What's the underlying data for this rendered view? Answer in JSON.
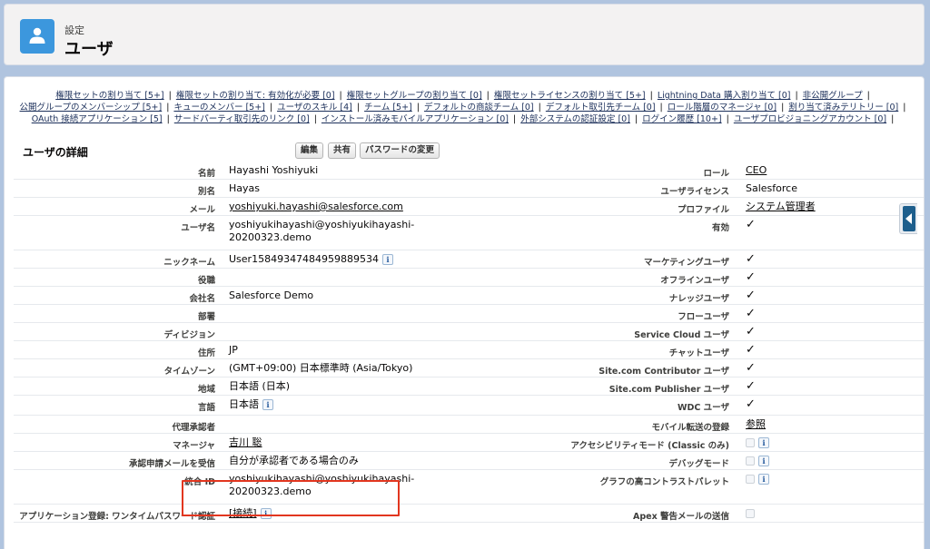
{
  "header": {
    "eyebrow": "設定",
    "title": "ユーザ",
    "icon": "user-icon"
  },
  "related_links": [
    [
      "権限セットの割り当て [5+]",
      "権限セットの割り当て: 有効化が必要 [0]",
      "権限セットグループの割り当て [0]",
      "権限セットライセンスの割り当て [5+]",
      "Lightning Data 購入割り当て [0]",
      "非公開グループ"
    ],
    [
      "公開グループのメンバーシップ [5+]",
      "キューのメンバー [5+]",
      "ユーザのスキル [4]",
      "チーム [5+]",
      "デフォルトの商談チーム [0]",
      "デフォルト取引先チーム [0]",
      "ロール階層のマネージャ [0]",
      "割り当て済みテリトリー [0]"
    ],
    [
      "OAuth 接続アプリケーション [5]",
      "サードパーティ取引先のリンク [0]",
      "インストール済みモバイルアプリケーション [0]",
      "外部システムの認証設定 [0]",
      "ログイン履歴 [10+]",
      "ユーザプロビジョニングアカウント [0]"
    ]
  ],
  "section": {
    "title": "ユーザの詳細",
    "buttons": [
      "編集",
      "共有",
      "パスワードの変更"
    ]
  },
  "left_fields": [
    {
      "label": "名前",
      "value": "Hayashi Yoshiyuki"
    },
    {
      "label": "別名",
      "value": "Hayas"
    },
    {
      "label": "メール",
      "value": "yoshiyuki.hayashi@salesforce.com",
      "link": true
    },
    {
      "label": "ユーザ名",
      "value": "yoshiyukihayashi@yoshiyukihayashi-20200323.demo"
    },
    {
      "label": "ニックネーム",
      "value": "User15849347484959889534",
      "info": true
    },
    {
      "label": "役職",
      "value": ""
    },
    {
      "label": "会社名",
      "value": "Salesforce Demo"
    },
    {
      "label": "部署",
      "value": ""
    },
    {
      "label": "ディビジョン",
      "value": ""
    },
    {
      "label": "住所",
      "value": "JP"
    },
    {
      "label": "タイムゾーン",
      "value": "(GMT+09:00) 日本標準時 (Asia/Tokyo)"
    },
    {
      "label": "地域",
      "value": "日本語 (日本)"
    },
    {
      "label": "言語",
      "value": "日本語",
      "info": true
    },
    {
      "label": "代理承認者",
      "value": ""
    },
    {
      "label": "マネージャ",
      "value": "吉川 聡",
      "link": true
    },
    {
      "label": "承認申請メールを受信",
      "value": "自分が承認者である場合のみ"
    },
    {
      "label": "統合 ID",
      "value": "yoshiyukihayashi@yoshiyukihayashi-20200323.demo"
    },
    {
      "label": "アプリケーション登録: ワンタイムパスワード認証",
      "value": "[接続]",
      "link": true,
      "info": true
    }
  ],
  "right_fields": [
    {
      "label": "ロール",
      "value": "CEO",
      "link": true
    },
    {
      "label": "ユーザライセンス",
      "value": "Salesforce"
    },
    {
      "label": "プロファイル",
      "value": "システム管理者",
      "link": true
    },
    {
      "label": "有効",
      "check": true
    },
    {
      "label": "マーケティングユーザ",
      "check": true
    },
    {
      "label": "オフラインユーザ",
      "check": true
    },
    {
      "label": "ナレッジユーザ",
      "check": true
    },
    {
      "label": "フローユーザ",
      "check": true
    },
    {
      "label": "Service Cloud ユーザ",
      "check": true
    },
    {
      "label": "チャットユーザ",
      "check": true
    },
    {
      "label": "Site.com Contributor ユーザ",
      "check": true
    },
    {
      "label": "Site.com Publisher ユーザ",
      "check": true
    },
    {
      "label": "WDC ユーザ",
      "check": true
    },
    {
      "label": "モバイル転送の登録",
      "value": "参照",
      "link": true
    },
    {
      "label": "アクセシビリティモード (Classic のみ)",
      "box": true,
      "info": true
    },
    {
      "label": "デバッグモード",
      "box": true,
      "info": true
    },
    {
      "label": "グラフの高コントラストパレット",
      "box": true,
      "info": true
    },
    {
      "label": "Apex 警告メールの送信",
      "box": true
    }
  ],
  "icons": {
    "info": "i",
    "check": "✓"
  },
  "colors": {
    "page_bg": "#b0c4df",
    "avatar": "#3c97dd",
    "highlight": "#e2361f"
  }
}
